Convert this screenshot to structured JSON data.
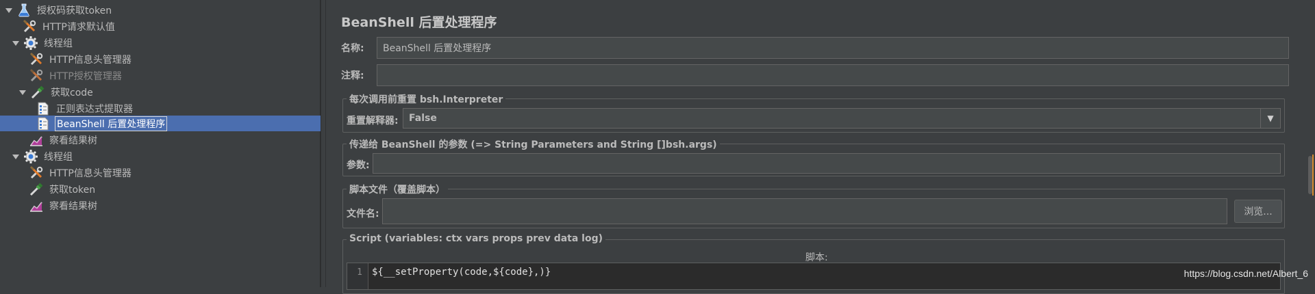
{
  "tree": {
    "items": [
      {
        "label": "授权码获取token",
        "icon": "flask-icon"
      },
      {
        "label": "HTTP请求默认值",
        "icon": "wrench-screwdriver-icon"
      },
      {
        "label": "线程组",
        "icon": "gear-icon"
      },
      {
        "label": "HTTP信息头管理器",
        "icon": "wrench-screwdriver-icon"
      },
      {
        "label": "HTTP授权管理器",
        "icon": "wrench-screwdriver-icon"
      },
      {
        "label": "获取code",
        "icon": "pipette-icon"
      },
      {
        "label": "正则表达式提取器",
        "icon": "document-icon"
      },
      {
        "label": "BeanShell 后置处理程序",
        "icon": "document-icon"
      },
      {
        "label": "察看结果树",
        "icon": "chart-icon"
      },
      {
        "label": "线程组",
        "icon": "gear-icon"
      },
      {
        "label": "HTTP信息头管理器",
        "icon": "wrench-screwdriver-icon"
      },
      {
        "label": "获取token",
        "icon": "pipette-icon"
      },
      {
        "label": "察看结果树",
        "icon": "chart-icon"
      }
    ]
  },
  "panel": {
    "title": "BeanShell 后置处理程序",
    "name_label": "名称:",
    "name_value": "BeanShell 后置处理程序",
    "comment_label": "注释:",
    "comment_value": "",
    "reset_group_title": "每次调用前重置 bsh.Interpreter",
    "reset_label": "重置解释器:",
    "reset_value": "False",
    "params_group_title": "传递给 BeanShell 的参数 (=> String Parameters and String []bsh.args)",
    "params_label": "参数:",
    "params_value": "",
    "file_group_title": "脚本文件（覆盖脚本）",
    "file_label": "文件名:",
    "file_value": "",
    "browse_label": "浏览...",
    "script_group_title": "Script (variables: ctx vars props prev data log)",
    "script_label": "脚本:",
    "line_number": "1",
    "code_line": "${__setProperty(code,${code},)}"
  },
  "watermark": "https://blog.csdn.net/Albert_6",
  "colors": {
    "background": "#3c3f41",
    "selection": "#4b6eaf",
    "field": "#45494a",
    "editor": "#2b2b2b"
  }
}
